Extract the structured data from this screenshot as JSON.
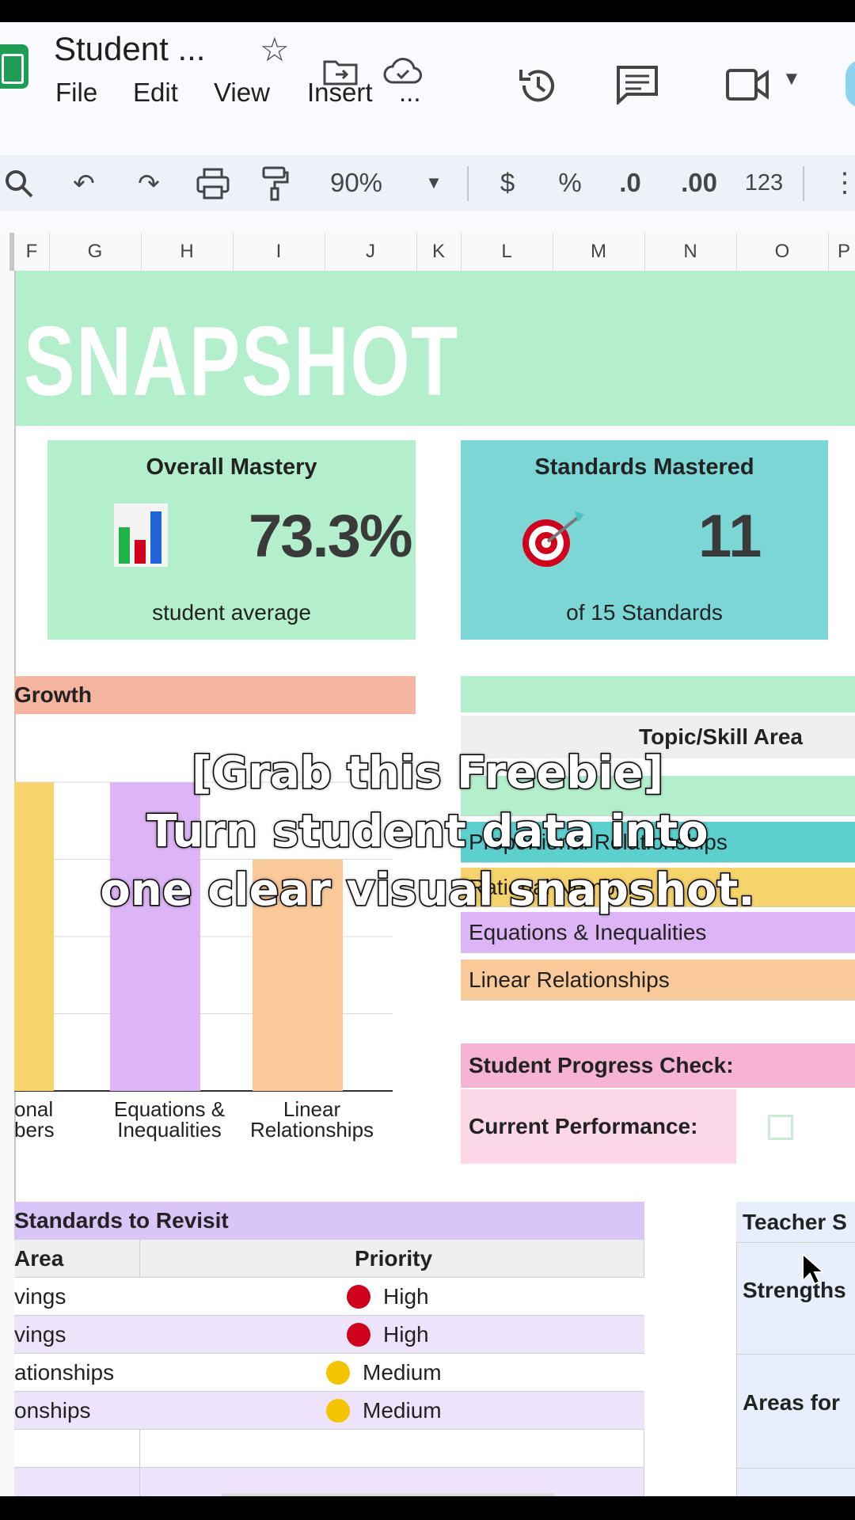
{
  "doc": {
    "title": "Student ...",
    "menus": [
      "File",
      "Edit",
      "View",
      "Insert",
      "..."
    ]
  },
  "toolbar": {
    "zoom": "90%",
    "currency": "$",
    "percent": "%",
    "dec_decrease": ".0",
    "dec_increase": ".00",
    "number_format": "123"
  },
  "columns": [
    "F",
    "G",
    "H",
    "I",
    "J",
    "K",
    "L",
    "M",
    "N",
    "O",
    "P"
  ],
  "sheet": {
    "banner_title": "SNAPSHOT",
    "mastery": {
      "title": "Overall Mastery",
      "value": "73.3%",
      "caption": "student average"
    },
    "standards": {
      "title": "Standards Mastered",
      "value": "11",
      "caption": "of 15 Standards"
    },
    "growth_header": "Growth",
    "topic_header": "Topic/Skill Area",
    "topics": [
      "Proportional Relationships",
      "Rational Numbers",
      "Equations & Inequalities",
      "Linear Relationships"
    ],
    "progress_header": "Student Progress Check:",
    "current_performance": "Current Performance:",
    "revisit_header": "Standards to Revisit",
    "revisit_col_area": "Area",
    "revisit_col_priority": "Priority",
    "revisit_rows": [
      {
        "area": "vings",
        "priority": "High",
        "color": "#d0021b"
      },
      {
        "area": "vings",
        "priority": "High",
        "color": "#d0021b"
      },
      {
        "area": "ationships",
        "priority": "Medium",
        "color": "#f5c400"
      },
      {
        "area": "onships",
        "priority": "Medium",
        "color": "#f5c400"
      }
    ],
    "teacher_header": "Teacher S",
    "strengths": "Strengths",
    "areas_for": "Areas for"
  },
  "caption": {
    "line1": "[Grab this Freebie]",
    "line2": "Turn student data into",
    "line3": "one clear visual snapshot."
  },
  "chart_data": {
    "type": "bar",
    "categories": [
      "onal bers",
      "Equations & Inequalities",
      "Linear Relationships"
    ],
    "colors": [
      "#f6d36b",
      "#ddb4f5",
      "#f9c99a"
    ],
    "values": [
      100,
      100,
      75
    ],
    "ylim": [
      0,
      100
    ],
    "grid": true
  }
}
